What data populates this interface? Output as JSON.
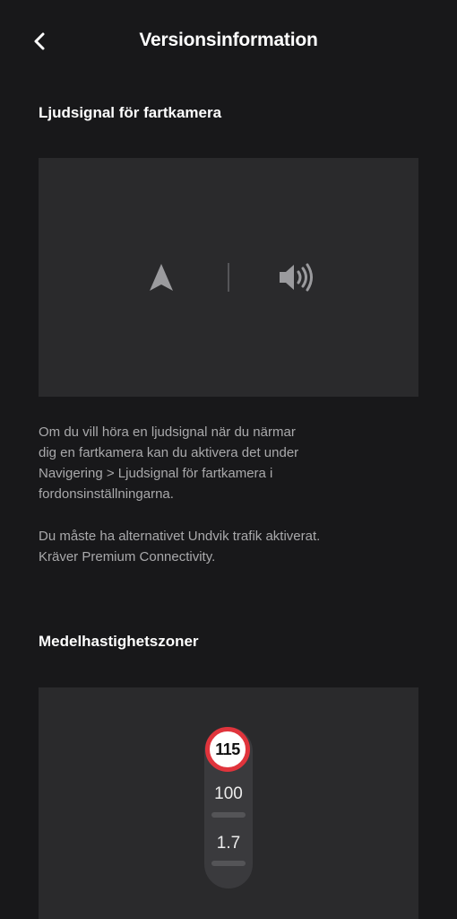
{
  "header": {
    "title": "Versionsinformation",
    "back_icon": "chevron-left-icon"
  },
  "speed_camera": {
    "title": "Ljudsignal för fartkamera",
    "icons": [
      "navigation-arrow-icon",
      "speaker-volume-icon"
    ],
    "description": "Om du vill höra en ljudsignal när du närmar\ndig en fartkamera kan du aktivera det under\nNavigering > Ljudsignal för fartkamera i\nfordonsinställningarna.",
    "note": "Du måste ha alternativet Undvik trafik aktiverat.\nKräver Premium Connectivity."
  },
  "average_speed": {
    "title": "Medelhastighetszoner",
    "sign_value": "115",
    "row1_value": "100",
    "row2_value": "1.7"
  },
  "colors": {
    "background": "#18181a",
    "card": "#2a2a2c",
    "sign_border": "#e0343c"
  }
}
